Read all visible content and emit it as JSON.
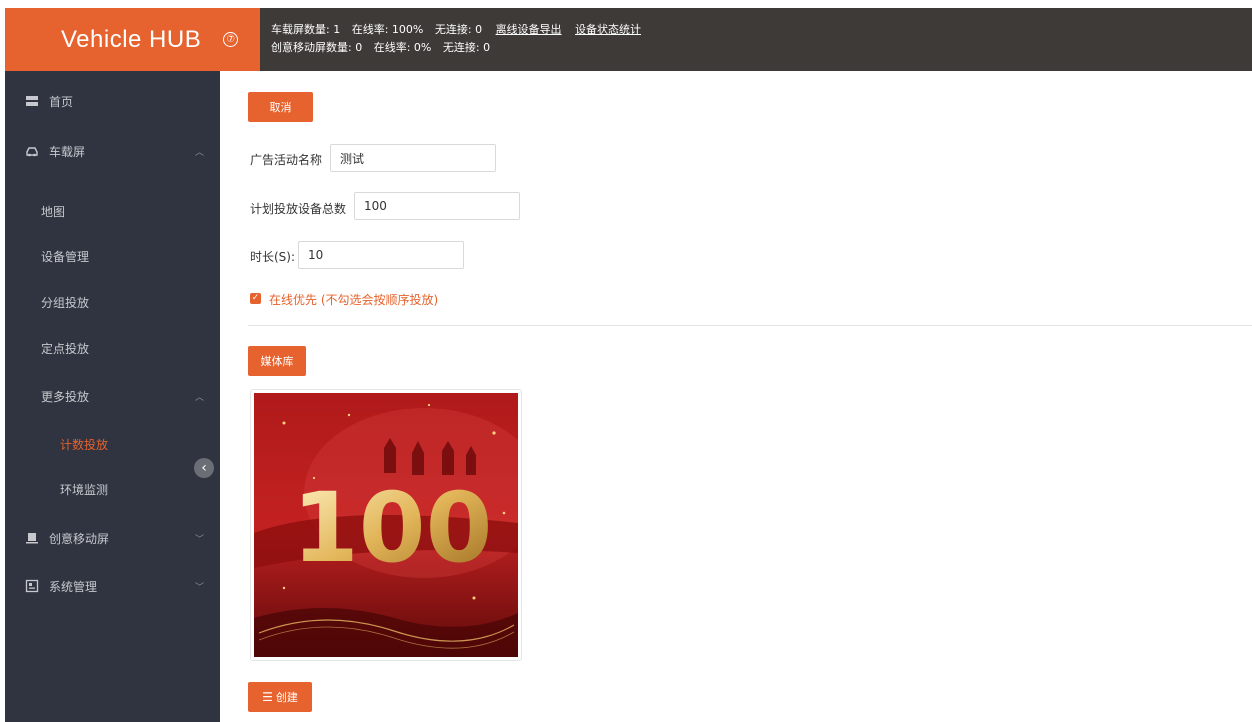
{
  "header": {
    "brand": "Vehicle HUB",
    "help_glyph": "⑦",
    "stats": {
      "line1": {
        "label": "车载屏数量",
        "count": "1",
        "online_label": "在线率",
        "online_rate": "100%",
        "offline_label": "无连接",
        "offline": "0"
      },
      "line2": {
        "label": "创意移动屏数量",
        "count": "0",
        "online_label": "在线率",
        "online_rate": "0%",
        "offline_label": "无连接",
        "offline": "0"
      },
      "export_link": "离线设备导出",
      "stats_link": "设备状态统计"
    }
  },
  "sidebar": {
    "home": "首页",
    "vehicle_screen": "车载屏",
    "map": "地图",
    "device_mgmt": "设备管理",
    "group_delivery": "分组投放",
    "fixed_delivery": "定点投放",
    "more_delivery": "更多投放",
    "count_delivery": "计数投放",
    "env_monitor": "环境监测",
    "creative_screen": "创意移动屏",
    "system_mgmt": "系统管理"
  },
  "form": {
    "cancel_button": "取消",
    "campaign_name_label": "广告活动名称",
    "campaign_name_value": "测试",
    "planned_devices_label": "计划投放设备总数",
    "planned_devices_value": "100",
    "duration_label": "时长(S):",
    "duration_value": "10",
    "online_first_label": "在线优先 (不勾选会按顺序投放)",
    "online_first_checked": true,
    "media_library_button": "媒体库",
    "media_image_text": "100",
    "create_button": "创建"
  },
  "colors": {
    "accent": "#e6622e",
    "sidebar": "#2f3440",
    "topbar": "#3d3a37"
  },
  "icons": {
    "help": "question-circle-icon",
    "home": "dashboard-icon",
    "car": "car-icon",
    "bus": "bus-icon",
    "system": "system-icon",
    "list": "list-icon"
  }
}
